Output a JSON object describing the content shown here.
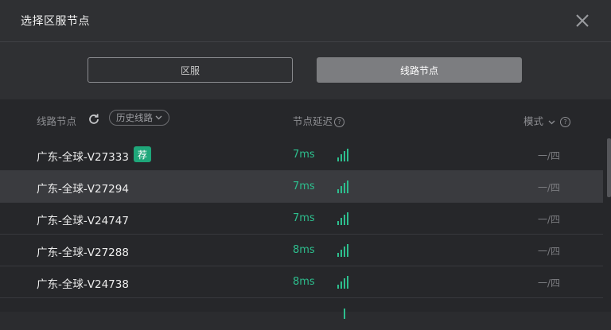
{
  "dialog": {
    "title": "选择区服节点"
  },
  "tabs": [
    {
      "label": "区服",
      "active": false
    },
    {
      "label": "线路节点",
      "active": true
    }
  ],
  "columns": {
    "node": "线路节点",
    "history": "历史线路",
    "latency": "节点延迟",
    "mode": "模式",
    "help_glyph": "?"
  },
  "nodes": [
    {
      "name": "广东-全球-V27333",
      "badge": "荐",
      "latency": "7ms",
      "mode": "一/四"
    },
    {
      "name": "广东-全球-V27294",
      "latency": "7ms",
      "mode": "一/四"
    },
    {
      "name": "广东-全球-V24747",
      "latency": "7ms",
      "mode": "一/四"
    },
    {
      "name": "广东-全球-V27288",
      "latency": "8ms",
      "mode": "一/四"
    },
    {
      "name": "广东-全球-V24738",
      "latency": "8ms",
      "mode": "一/四"
    }
  ],
  "colors": {
    "accent_green": "#2dbf8e",
    "badge_green": "#1fa77a",
    "active_tab": "#7c7d80"
  },
  "icons": {
    "close": "close-icon",
    "refresh": "refresh-icon",
    "chevron": "chevron-down-icon",
    "help": "help-icon",
    "signal": "signal-icon"
  }
}
